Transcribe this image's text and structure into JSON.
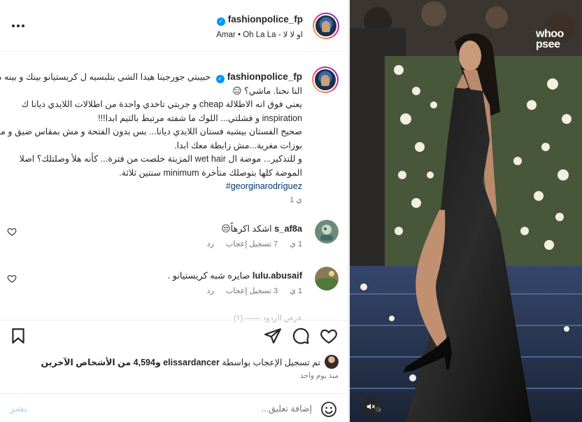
{
  "post": {
    "username": "fashionpolice_fp",
    "audio": {
      "artist": "Amar",
      "separator": "•",
      "song": "Oh La La - او لا لا"
    },
    "more_icon": "more-horizontal-icon"
  },
  "caption": {
    "username": "fashionpolice_fp",
    "lines": [
      "حبيبتي جورجينا هيدا الشي بتلبسيه ل كريستيانو بينك و بينه مش",
      "النا نحنا. ماشي؟ 😑",
      "يعني فوق انه الاطلالة cheap و جربتي تاخدي واحدة من اطلالات اللايدي ديانا ك",
      "inspiration و فشلتي... اللوك ما شفته مرتبط بالثيم ابدا!!!",
      "صحيح الفستان بيشبه فستان اللايدي ديانا... بس بدون الفتحة و مش بمقاس ضيق و مش ب",
      "بوزات مغرية...مش زابطة معك ابدا.",
      "و للتذكير... موضة ال wet hair المزيتة خلصت من فترة... كأنه هلأ وصلتلك؟ اصلا",
      "الموضة كلها بتوصلك متأخرة minimum سنتين ثلاثة."
    ],
    "hashtag": "#georginarodríguez",
    "time": "1 ي"
  },
  "comments": [
    {
      "username": "s_af8a",
      "text": "اشكد اكرهاً😒",
      "time": "1 ي",
      "likes": "7 تسجيل إعجاب",
      "reply": "رد"
    },
    {
      "username": "lulu.abusaif",
      "text": "صايره شبه كريستيانو .",
      "time": "1 ي",
      "likes": "3 تسجيل إعجاب",
      "reply": "رد"
    }
  ],
  "more_replies": "(1) —— عرض الردود",
  "actions": {
    "like_icon": "heart-icon",
    "comment_icon": "comment-icon",
    "share_icon": "send-icon",
    "save_icon": "bookmark-icon"
  },
  "likes": {
    "prefix": "تم تسجيل الإعجاب بواسطة",
    "user": "elissardancer",
    "conj": "و",
    "count": "4,594",
    "suffix": "من الأشخاص الآخرين"
  },
  "post_date": "منذ يوم واحد",
  "add_comment": {
    "placeholder": "إضافة تعليق...",
    "post_label": "نشر",
    "emoji_icon": "smiley-icon"
  },
  "media": {
    "watermark_line1": "whoo",
    "watermark_line2": "psee",
    "mute_icon": "muted-speaker-icon"
  },
  "colors": {
    "accent": "#0095f6",
    "link": "#00376b",
    "secondary_text": "#737373"
  }
}
